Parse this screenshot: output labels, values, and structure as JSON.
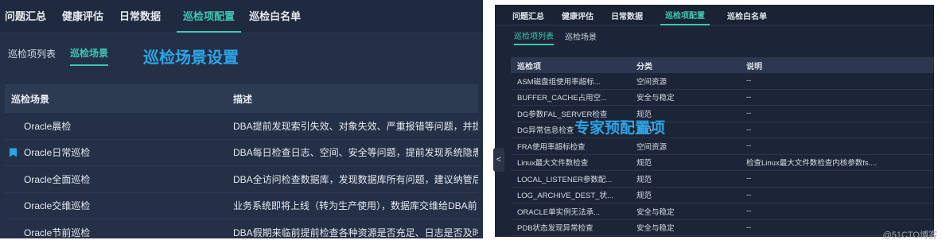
{
  "left": {
    "topnav": [
      "问题汇总",
      "健康评估",
      "日常数据",
      "巡检项配置",
      "巡检白名单"
    ],
    "topnav_active": 3,
    "subnav": [
      "巡检项列表",
      "巡检场景"
    ],
    "subnav_active": 1,
    "overlay_title": "巡检场景设置",
    "table": {
      "headers": [
        "巡检场景",
        "描述"
      ],
      "rows": [
        {
          "name": "Oracle晨检",
          "desc": "DBA提前发现索引失效、对象失效、严重报错等问题，并提",
          "bookmark": false
        },
        {
          "name": "Oracle日常巡检",
          "desc": "DBA每日检查日志、空间、安全等问题，提前发现系统隐患",
          "bookmark": true
        },
        {
          "name": "Oracle全面巡检",
          "desc": "DBA全访问检查数据库，发现数据库所有问题，建议纳管后",
          "bookmark": false
        },
        {
          "name": "Oracle交维巡检",
          "desc": "业务系统即将上线（转为生产使用），数据库交维给DBA前",
          "bookmark": false
        },
        {
          "name": "Oracle节前巡检",
          "desc": "DBA假期来临前提前检查各种资源是否充足、日志是否及时",
          "bookmark": false
        }
      ]
    },
    "colors": {
      "accent": "#3fc6b4",
      "overlay": "#2aa6e8",
      "bg": "#243046"
    }
  },
  "right": {
    "topnav": [
      "问题汇总",
      "健康评估",
      "日常数据",
      "巡检项配置",
      "巡检白名单"
    ],
    "topnav_active": 3,
    "subnav": [
      "巡检项列表",
      "巡检场景"
    ],
    "subnav_active": 0,
    "overlay_title": "专家预配置项",
    "table": {
      "headers": [
        "巡检项",
        "分类",
        "说明"
      ],
      "rows": [
        {
          "item": "ASM磁盘组使用率超标...",
          "cat": "空间资源",
          "desc": "--"
        },
        {
          "item": "BUFFER_CACHE占用空...",
          "cat": "安全与稳定",
          "desc": "--"
        },
        {
          "item": "DG参数FAL_SERVER检查",
          "cat": "规范",
          "desc": "--"
        },
        {
          "item": "DG异常信息检查",
          "cat": "规范",
          "desc": "--"
        },
        {
          "item": "FRA使用率超标检查",
          "cat": "空间资源",
          "desc": "--"
        },
        {
          "item": "Linux最大文件数检查",
          "cat": "规范",
          "desc": "检查Linux最大文件数检查内核参数fs...."
        },
        {
          "item": "LOCAL_LISTENER参数配...",
          "cat": "规范",
          "desc": "--"
        },
        {
          "item": "LOG_ARCHIVE_DEST_状...",
          "cat": "规范",
          "desc": "--"
        },
        {
          "item": "ORACLE单实例无法承...",
          "cat": "安全与稳定",
          "desc": "--"
        },
        {
          "item": "PDB状态发现异常检查",
          "cat": "安全与稳定",
          "desc": "--"
        }
      ]
    },
    "collapse_glyph": "<"
  },
  "site_mark": "@51CTO博客"
}
